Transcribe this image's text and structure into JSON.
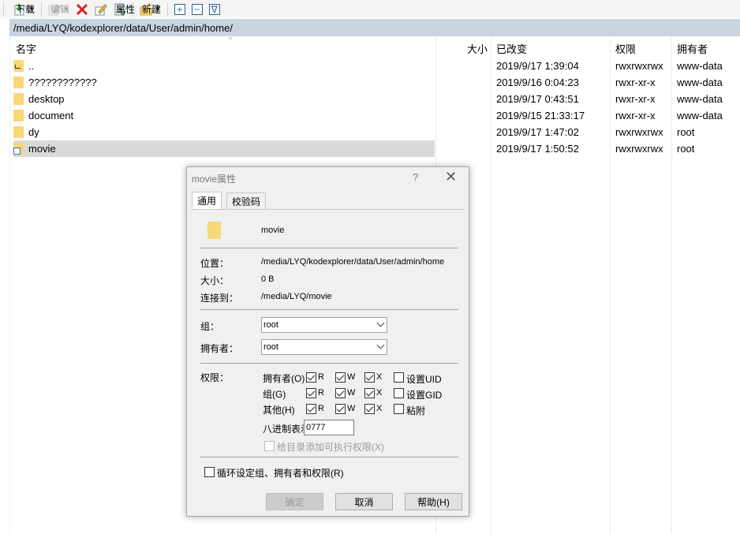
{
  "toolbar": {
    "download_label": "下载",
    "edit_label": "编辑",
    "properties_label": "属性",
    "new_label": "新建",
    "expand_icon": "plus-box-icon",
    "collapse_icon": "minus-box-icon",
    "filter_icon": "filter-box-icon",
    "plus_glyph": "+",
    "minus_glyph": "−",
    "filter_glyph": "∇",
    "delete_color": "#d9221c"
  },
  "path": "/media/LYQ/kodexplorer/data/User/admin/home/",
  "columns": {
    "name": "名字",
    "size": "大小",
    "modified": "已改变",
    "permissions": "权限",
    "owner": "拥有者"
  },
  "files": [
    {
      "name": "..",
      "modified": "2019/9/17 1:39:04",
      "perm": "rwxrwxrwx",
      "owner": "www-data",
      "icon": "parent-folder-icon"
    },
    {
      "name": "????????????",
      "modified": "2019/9/16 0:04:23",
      "perm": "rwxr-xr-x",
      "owner": "www-data",
      "icon": "folder-icon"
    },
    {
      "name": "desktop",
      "modified": "2019/9/17 0:43:51",
      "perm": "rwxr-xr-x",
      "owner": "www-data",
      "icon": "folder-icon"
    },
    {
      "name": "document",
      "modified": "2019/9/15 21:33:17",
      "perm": "rwxr-xr-x",
      "owner": "www-data",
      "icon": "folder-icon"
    },
    {
      "name": "dy",
      "modified": "2019/9/17 1:47:02",
      "perm": "rwxrwxrwx",
      "owner": "root",
      "icon": "folder-icon"
    },
    {
      "name": "movie",
      "modified": "2019/9/17 1:50:52",
      "perm": "rwxrwxrwx",
      "owner": "root",
      "icon": "folder-link-icon",
      "selected": true
    }
  ],
  "dialog": {
    "title": "movie属性",
    "help": "?",
    "close": "✕",
    "tabs": [
      "通用",
      "校验码"
    ],
    "filename": "movie",
    "location_label": "位置：",
    "location_value": "/media/LYQ/kodexplorer/data/User/admin/home",
    "size_label": "大小：",
    "size_value": "0 B",
    "link_label": "连接到：",
    "link_value": "/media/LYQ/movie",
    "group_label": "组：",
    "group_value": "root",
    "owner_label": "拥有者：",
    "owner_value": "root",
    "perm_label": "权限：",
    "perm_rows": [
      {
        "label": "拥有者(O)",
        "r": "R",
        "w": "W",
        "x": "X",
        "extra": "设置UID"
      },
      {
        "label": "组(G)",
        "r": "R",
        "w": "W",
        "x": "X",
        "extra": "设置GID"
      },
      {
        "label": "其他(H)",
        "r": "R",
        "w": "W",
        "x": "X",
        "extra": "粘附"
      }
    ],
    "octal_label": "八进制表示",
    "octal_value": "0777",
    "exec_dirs_label": "给目录添加可执行权限(X)",
    "recursive_label": "循环设定组、拥有者和权限(R)",
    "ok_label": "确定",
    "cancel_label": "取消",
    "help_button_label": "帮助(H)"
  }
}
